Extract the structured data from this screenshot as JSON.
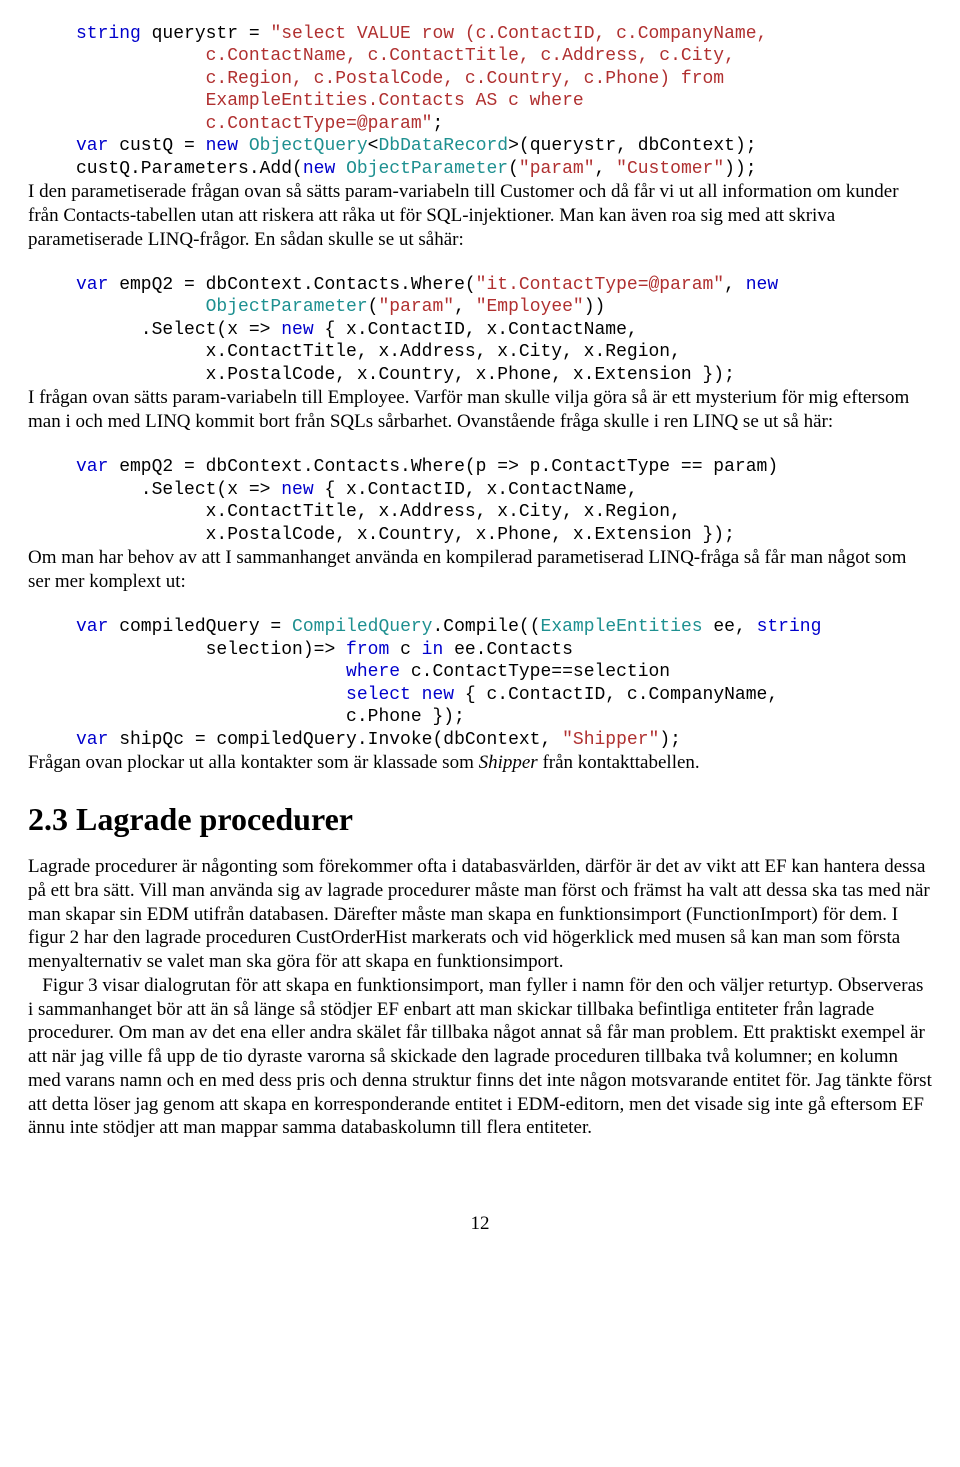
{
  "code1_l1a": "string",
  "code1_l1b": " querystr = ",
  "code1_l1c": "\"select VALUE row (c.ContactID, c.CompanyName,",
  "code1_l2": "            c.ContactName, c.ContactTitle, c.Address, c.City,",
  "code1_l3": "            c.Region, c.PostalCode, c.Country, c.Phone) from",
  "code1_l4": "            ExampleEntities.Contacts AS c where",
  "code1_l5": "            c.ContactType=@param\"",
  "code1_l5b": ";",
  "code1_l6a": "var",
  "code1_l6b": " custQ = ",
  "code1_l6c": "new",
  "code1_l6d": " ",
  "code1_l6e": "ObjectQuery",
  "code1_l6f": "<",
  "code1_l6g": "DbDataRecord",
  "code1_l6h": ">(querystr, dbContext);",
  "code1_l7a": "custQ.Parameters.Add(",
  "code1_l7b": "new",
  "code1_l7c": " ",
  "code1_l7d": "ObjectParameter",
  "code1_l7e": "(",
  "code1_l7f": "\"param\"",
  "code1_l7g": ", ",
  "code1_l7h": "\"Customer\"",
  "code1_l7i": "));",
  "para1": "I den parametiserade frågan ovan så sätts param-variabeln till Customer och då får vi ut all information om kunder från Contacts-tabellen utan att riskera att råka ut för SQL-injektioner. Man kan även roa sig med att skriva parametiserade LINQ-frågor. En sådan skulle se ut såhär:",
  "code2_l1a": "var",
  "code2_l1b": " empQ2 = dbContext.Contacts.Where(",
  "code2_l1c": "\"it.ContactType=@param\"",
  "code2_l1d": ", ",
  "code2_l1e": "new",
  "code2_l2a": "            ",
  "code2_l2b": "ObjectParameter",
  "code2_l2c": "(",
  "code2_l2d": "\"param\"",
  "code2_l2e": ", ",
  "code2_l2f": "\"Employee\"",
  "code2_l2g": "))",
  "code2_l3a": "      .Select(x => ",
  "code2_l3b": "new",
  "code2_l3c": " { x.ContactID, x.ContactName,",
  "code2_l4": "            x.ContactTitle, x.Address, x.City, x.Region,",
  "code2_l5": "            x.PostalCode, x.Country, x.Phone, x.Extension });",
  "para2": "I frågan ovan sätts param-variabeln till Employee. Varför man skulle vilja göra så är ett mysterium för mig eftersom man i och med LINQ kommit bort från SQLs sårbarhet. Ovanstående fråga skulle i ren LINQ se ut så här:",
  "code3_l1a": "var",
  "code3_l1b": " empQ2 = dbContext.Contacts.Where(p => p.ContactType == param)",
  "code3_l2a": "      .Select(x => ",
  "code3_l2b": "new",
  "code3_l2c": " { x.ContactID, x.ContactName,",
  "code3_l3": "            x.ContactTitle, x.Address, x.City, x.Region,",
  "code3_l4": "            x.PostalCode, x.Country, x.Phone, x.Extension });",
  "para3": "Om man har behov av att I sammanhanget använda en kompilerad parametiserad LINQ-fråga så får man något som ser mer komplext ut:",
  "code4_l1a": "var",
  "code4_l1b": " compiledQuery = ",
  "code4_l1c": "CompiledQuery",
  "code4_l1d": ".Compile((",
  "code4_l1e": "ExampleEntities",
  "code4_l1f": " ee, ",
  "code4_l1g": "string",
  "code4_l2a": "            selection)=> ",
  "code4_l2b": "from",
  "code4_l2c": " c ",
  "code4_l2d": "in",
  "code4_l2e": " ee.Contacts",
  "code4_l3a": "                         ",
  "code4_l3b": "where",
  "code4_l3c": " c.ContactType==selection",
  "code4_l4a": "                         ",
  "code4_l4b": "select",
  "code4_l4c": " ",
  "code4_l4d": "new",
  "code4_l4e": " { c.ContactID, c.CompanyName,",
  "code4_l5": "                         c.Phone });",
  "code4_l6a": "var",
  "code4_l6b": " shipQc = compiledQuery.Invoke(dbContext, ",
  "code4_l6c": "\"Shipper\"",
  "code4_l6d": ");",
  "para4a": "Frågan ovan plockar ut alla kontakter som är klassade som ",
  "para4b": "Shipper",
  "para4c": " från kontakttabellen.",
  "heading": "2.3 Lagrade procedurer",
  "para5": "Lagrade procedurer är någonting som förekommer ofta i databasvärlden, därför är det av vikt att EF kan hantera dessa på ett bra sätt. Vill man använda sig av lagrade procedurer måste man först och främst ha valt att dessa ska tas med när man skapar sin EDM utifrån databasen. Därefter måste man skapa en funktionsimport (FunctionImport) för dem. I figur 2 har den lagrade proceduren CustOrderHist markerats och vid högerklick med musen så kan man som första menyalternativ se valet man ska göra för att skapa en funktionsimport.",
  "para6": "   Figur 3 visar dialogrutan för att skapa en funktionsimport, man fyller i namn för den och väljer returtyp. Observeras i sammanhanget bör att än så länge så stödjer EF enbart att man skickar tillbaka befintliga entiteter från lagrade procedurer. Om man av det ena eller andra skälet får tillbaka något annat så får man problem. Ett praktiskt exempel är att när jag ville få upp de tio dyraste varorna så skickade den lagrade proceduren tillbaka två kolumner; en kolumn med varans namn och en med dess pris och denna struktur finns det inte någon motsvarande entitet för. Jag tänkte först att detta löser jag genom att skapa en korresponderande entitet i EDM-editorn, men det visade sig inte gå eftersom EF ännu inte stödjer att man mappar samma databaskolumn till flera entiteter.",
  "pagenum": "12"
}
